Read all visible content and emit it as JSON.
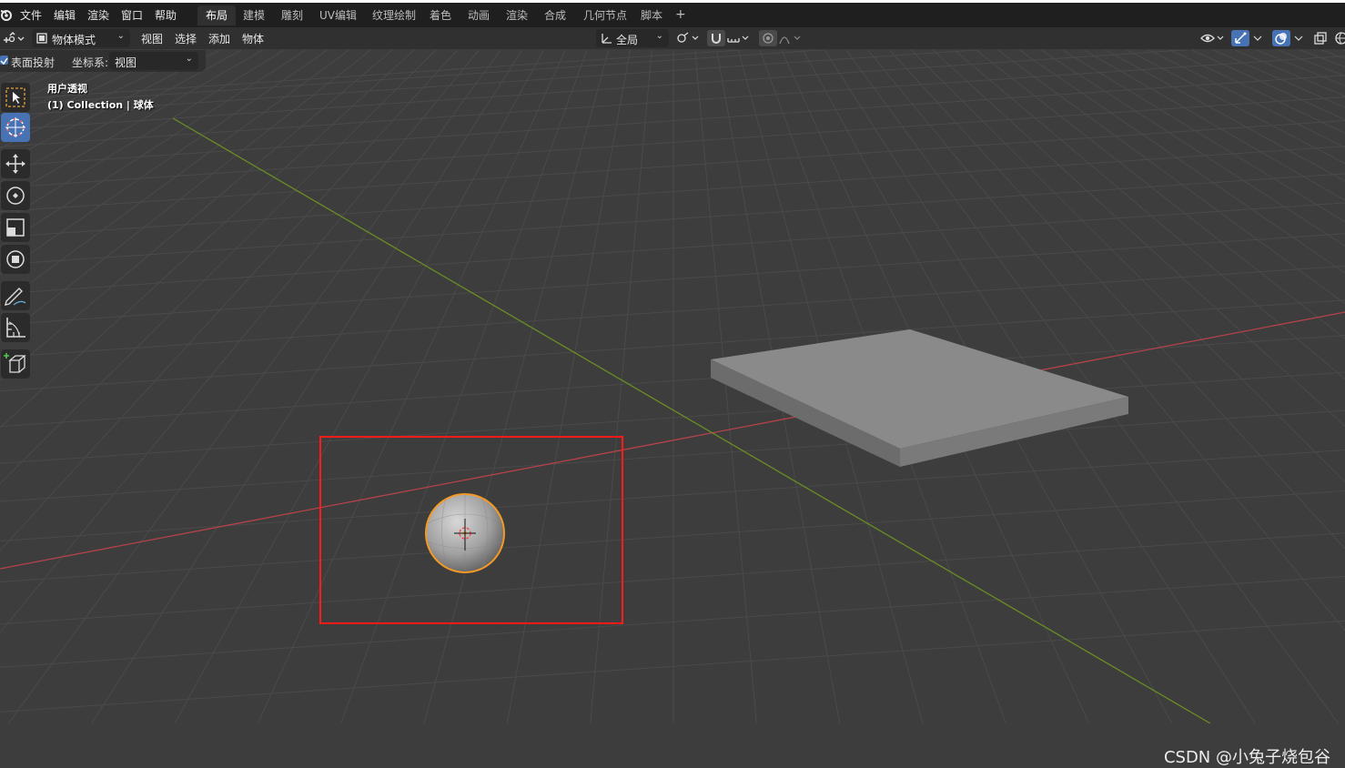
{
  "menu": [
    "文件",
    "编辑",
    "渲染",
    "窗口",
    "帮助"
  ],
  "workspaces": [
    "布局",
    "建模",
    "雕刻",
    "UV编辑",
    "纹理绘制",
    "着色",
    "动画",
    "渲染",
    "合成",
    "几何节点",
    "脚本"
  ],
  "active_workspace": "布局",
  "add_workspace": "+",
  "header": {
    "mode": "物体模式",
    "menus": [
      "视图",
      "选择",
      "添加",
      "物体"
    ],
    "orientation": "全局"
  },
  "toolsettings": {
    "surface_project": "表面投射",
    "coord_label": "坐标系:",
    "coord_value": "视图"
  },
  "viewport": {
    "view_name": "用户透视",
    "collection": "(1) Collection | 球体"
  },
  "tools": [
    "select-box",
    "cursor",
    "move",
    "rotate",
    "scale",
    "transform",
    "annotate",
    "measure",
    "add-cube"
  ],
  "colors": {
    "x_axis": "#b5424a",
    "y_axis": "#6b8e23",
    "selection_outline": "#f59a23",
    "highlight_box": "#ff1a1a",
    "accent": "#4772b3"
  },
  "watermark": "CSDN @小兔子烧包谷"
}
